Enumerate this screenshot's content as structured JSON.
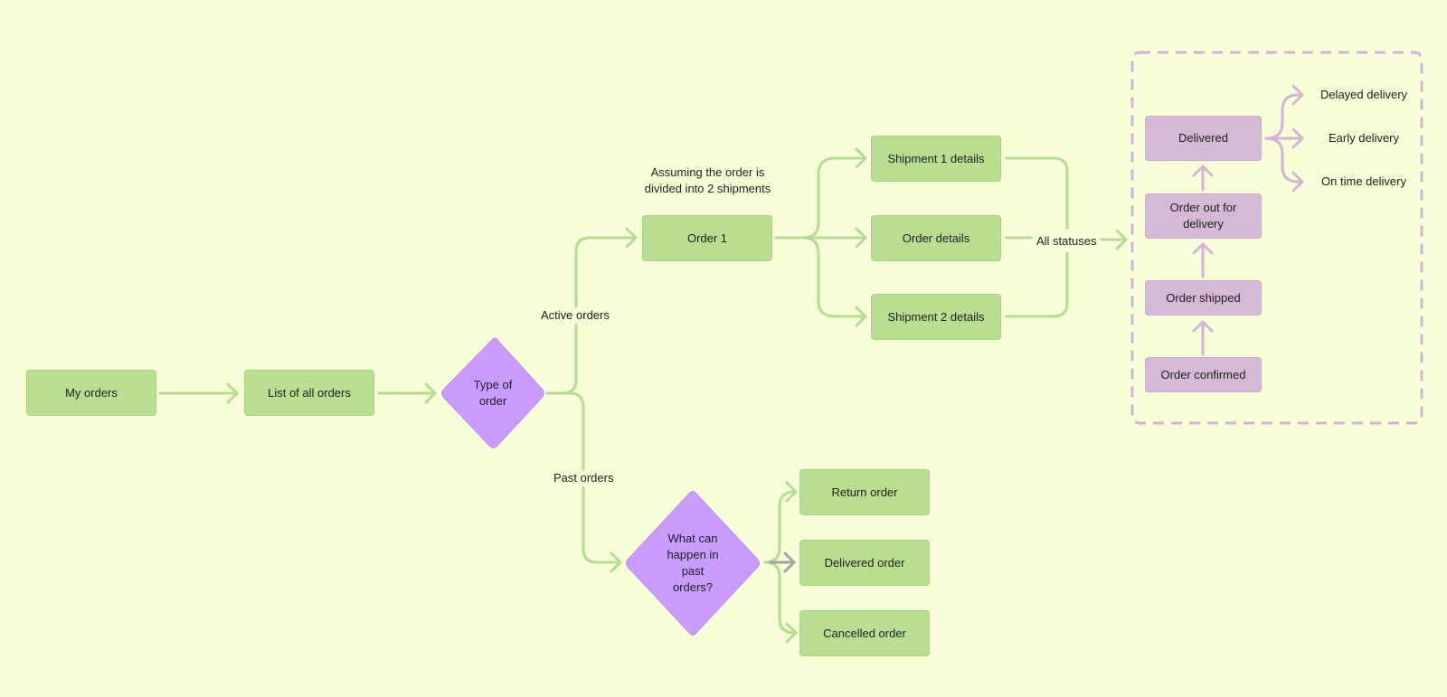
{
  "colors": {
    "background": "#f8fed7",
    "green_node": "#b8de91",
    "green_edge": "#b5dd8f",
    "decision": "#c99cff",
    "status_node": "#d6b9d6",
    "status_edge": "#d4b3d4",
    "gray_arrow": "#a8a3a3"
  },
  "nodes": {
    "my_orders": "My orders",
    "list_of_all_orders": "List of all orders",
    "type_of_order": "Type of order",
    "order_1": "Order 1",
    "shipment_1_details": "Shipment 1 details",
    "order_details": "Order details",
    "shipment_2_details": "Shipment 2 details",
    "what_can_happen": "What can happen in past orders?",
    "return_order": "Return order",
    "delivered_order": "Delivered order",
    "cancelled_order": "Cancelled order"
  },
  "edge_labels": {
    "active_orders": "Active orders",
    "past_orders": "Past orders",
    "all_statuses": "All statuses"
  },
  "annotations": {
    "shipment_note": "Assuming the order is divided into 2 shipments"
  },
  "status_group": {
    "stages": [
      "Order confirmed",
      "Order shipped",
      "Order out for delivery",
      "Delivered"
    ],
    "delivery_outcomes": [
      "Delayed delivery",
      "Early delivery",
      "On time delivery"
    ]
  }
}
